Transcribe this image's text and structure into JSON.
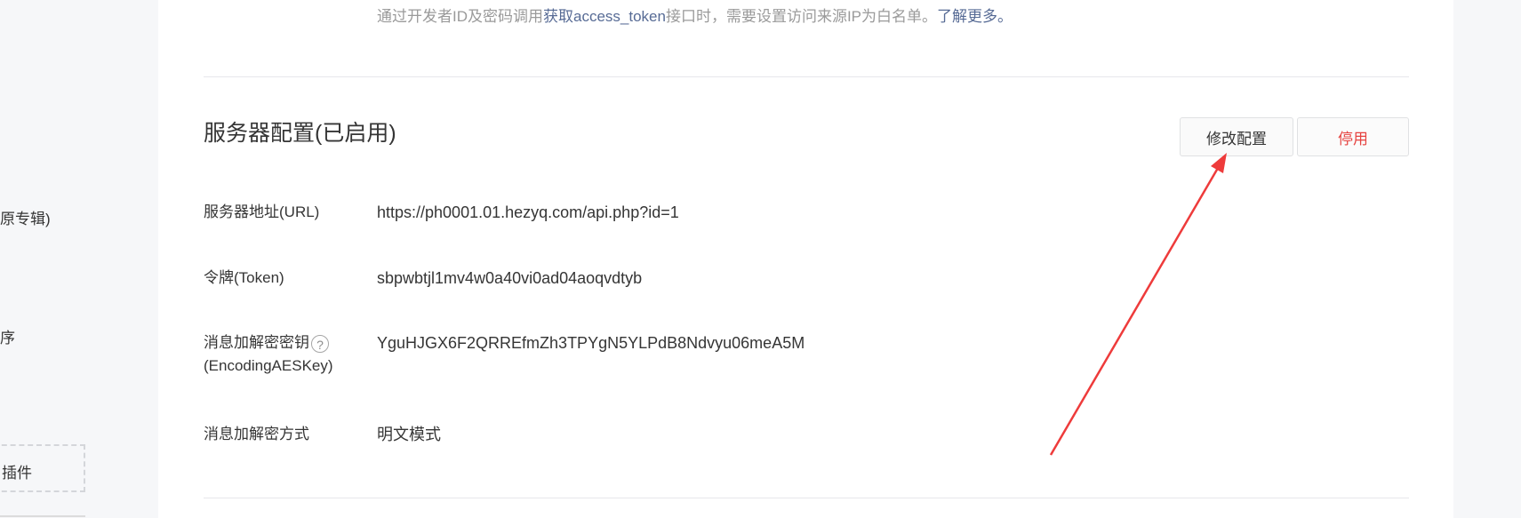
{
  "sidebar": {
    "items": [
      {
        "label": "原专辑)"
      },
      {
        "label": "序"
      },
      {
        "label": "插件"
      }
    ]
  },
  "main": {
    "tip": {
      "before": "通过开发者ID及密码调用",
      "link1": "获取access_token",
      "middle": "接口时，需要设置访问来源IP为白名单。",
      "link2": "了解更多。"
    },
    "section_title": "服务器配置(已启用)",
    "buttons": {
      "modify": "修改配置",
      "disable": "停用"
    },
    "rows": [
      {
        "label": "服务器地址(URL)",
        "value": "https://ph0001.01.hezyq.com/api.php?id=1"
      },
      {
        "label": "令牌(Token)",
        "value": "sbpwbtjl1mv4w0a40vi0ad04aoqvdtyb"
      },
      {
        "label_line1": "消息加解密密钥",
        "label_line2": "(EncodingAESKey)",
        "help": "?",
        "value": "YguHJGX6F2QRREfmZh3TPYgN5YLPdB8Ndvyu06meA5M"
      },
      {
        "label": "消息加解密方式",
        "value": "明文模式"
      }
    ]
  },
  "annotation": {
    "arrow_color": "#ee3b3b"
  }
}
